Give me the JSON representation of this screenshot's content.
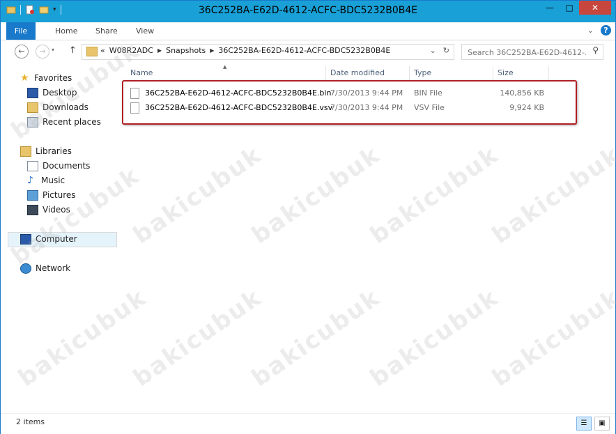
{
  "window": {
    "title": "36C252BA-E62D-4612-ACFC-BDC5232B0B4E",
    "controls": {
      "minimize": "—",
      "maximize": "□",
      "close": "✕"
    }
  },
  "ribbon": {
    "tabs": [
      "File",
      "Home",
      "Share",
      "View"
    ],
    "expand_glyph": "⌄",
    "help": "?"
  },
  "address_bar": {
    "overflow": "«",
    "breadcrumbs": [
      "W08R2ADC",
      "Snapshots",
      "36C252BA-E62D-4612-ACFC-BDC5232B0B4E"
    ],
    "dropdown_glyph": "⌄",
    "refresh_glyph": "↻"
  },
  "search": {
    "placeholder": "Search 36C252BA-E62D-4612-..."
  },
  "navigation": {
    "favorites": {
      "label": "Favorites",
      "items": [
        "Desktop",
        "Downloads",
        "Recent places"
      ]
    },
    "libraries": {
      "label": "Libraries",
      "items": [
        "Documents",
        "Music",
        "Pictures",
        "Videos"
      ]
    },
    "computer": "Computer",
    "network": "Network"
  },
  "file_list": {
    "columns": [
      "Name",
      "Date modified",
      "Type",
      "Size"
    ],
    "rows": [
      {
        "name": "36C252BA-E62D-4612-ACFC-BDC5232B0B4E.bin",
        "date": "7/30/2013 9:44 PM",
        "type": "BIN File",
        "size": "140,856 KB"
      },
      {
        "name": "36C252BA-E62D-4612-ACFC-BDC5232B0B4E.vsv",
        "date": "7/30/2013 9:44 PM",
        "type": "VSV File",
        "size": "9,924 KB"
      }
    ]
  },
  "status_bar": {
    "item_count": "2 items"
  },
  "watermark": {
    "text": "bakicubuk"
  },
  "colors": {
    "accent": "#19a0d7",
    "file_tab": "#1979ca",
    "close_button": "#c7463d",
    "highlight_box": "#b01f23"
  }
}
